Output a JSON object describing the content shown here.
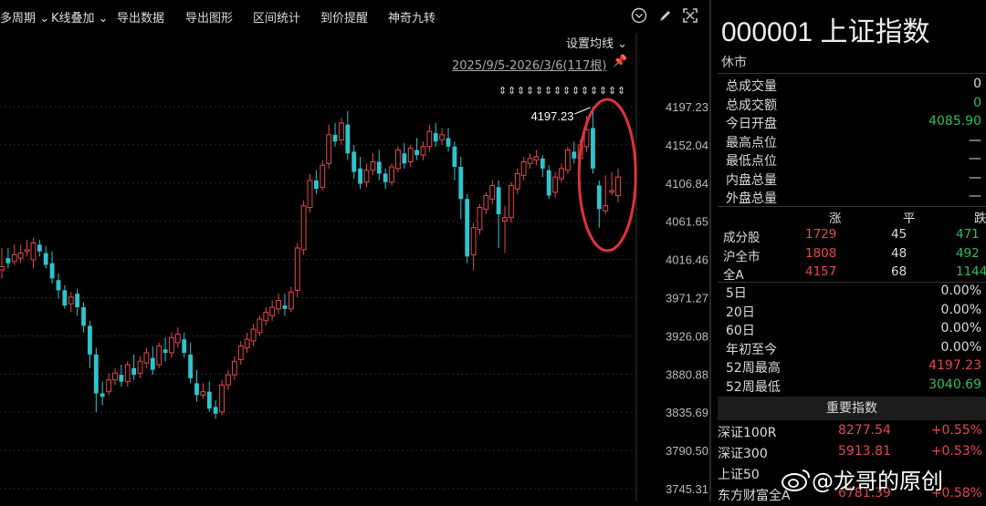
{
  "toolbar": {
    "items": [
      "多周期 ⌄",
      "K线叠加 ⌄",
      "导出数据",
      "导出图形",
      "区间统计",
      "到价提醒",
      "神奇九转"
    ],
    "icons": [
      "chevron-circle-icon",
      "brush-icon",
      "fullscreen-icon"
    ]
  },
  "chart_header": {
    "settings_label": "设置均线 ⌄",
    "range_label": "2025/9/5-2026/3/6(117根)"
  },
  "chart_data": {
    "type": "candlestick",
    "y_ticks": [
      "4197.23",
      "4152.04",
      "4106.84",
      "4061.65",
      "4016.46",
      "3971.27",
      "3926.08",
      "3880.88",
      "3835.69",
      "3790.50",
      "3745.31"
    ],
    "ylim": [
      3745.31,
      4197.23
    ],
    "annotation": "4197.23",
    "highlight": "circled last 6 candles",
    "colors": {
      "up": "#e5484d",
      "down": "#2ec4cc",
      "circle": "#e0323c"
    },
    "candles": [
      [
        4004,
        4030,
        4008,
        3994
      ],
      [
        4018,
        4030,
        4012,
        4006
      ],
      [
        4014,
        4034,
        4022,
        4010
      ],
      [
        4018,
        4034,
        4024,
        4012
      ],
      [
        4026,
        4040,
        4028,
        4020
      ],
      [
        4016,
        4042,
        4036,
        4006
      ],
      [
        4034,
        4040,
        4026,
        4020
      ],
      [
        4024,
        4032,
        4010,
        4006
      ],
      [
        4012,
        4026,
        3994,
        3988
      ],
      [
        3992,
        4000,
        3980,
        3970
      ],
      [
        3980,
        3986,
        3962,
        3958
      ],
      [
        3964,
        3978,
        3972,
        3954
      ],
      [
        3976,
        3982,
        3960,
        3950
      ],
      [
        3960,
        3966,
        3938,
        3930
      ],
      [
        3938,
        3944,
        3904,
        3888
      ],
      [
        3904,
        3912,
        3858,
        3836
      ],
      [
        3858,
        3872,
        3854,
        3844
      ],
      [
        3860,
        3882,
        3874,
        3856
      ],
      [
        3874,
        3888,
        3882,
        3868
      ],
      [
        3880,
        3892,
        3872,
        3866
      ],
      [
        3872,
        3896,
        3892,
        3866
      ],
      [
        3888,
        3904,
        3880,
        3874
      ],
      [
        3882,
        3902,
        3896,
        3876
      ],
      [
        3894,
        3912,
        3906,
        3888
      ],
      [
        3900,
        3914,
        3886,
        3880
      ],
      [
        3892,
        3918,
        3914,
        3888
      ],
      [
        3910,
        3924,
        3906,
        3896
      ],
      [
        3906,
        3930,
        3924,
        3900
      ],
      [
        3918,
        3936,
        3928,
        3912
      ],
      [
        3922,
        3930,
        3906,
        3900
      ],
      [
        3904,
        3918,
        3876,
        3870
      ],
      [
        3870,
        3886,
        3856,
        3848
      ],
      [
        3856,
        3870,
        3860,
        3852
      ],
      [
        3860,
        3872,
        3840,
        3836
      ],
      [
        3842,
        3850,
        3834,
        3828
      ],
      [
        3836,
        3874,
        3868,
        3832
      ],
      [
        3868,
        3886,
        3880,
        3862
      ],
      [
        3880,
        3902,
        3896,
        3874
      ],
      [
        3898,
        3920,
        3914,
        3892
      ],
      [
        3912,
        3930,
        3922,
        3906
      ],
      [
        3920,
        3940,
        3934,
        3914
      ],
      [
        3930,
        3950,
        3946,
        3926
      ],
      [
        3944,
        3960,
        3954,
        3938
      ],
      [
        3950,
        3968,
        3960,
        3944
      ],
      [
        3958,
        3976,
        3968,
        3952
      ],
      [
        3962,
        3976,
        3958,
        3950
      ],
      [
        3958,
        3984,
        3978,
        3954
      ],
      [
        3980,
        4036,
        4030,
        3972
      ],
      [
        4028,
        4086,
        4080,
        4022
      ],
      [
        4078,
        4118,
        4110,
        4072
      ],
      [
        4110,
        4122,
        4100,
        4094
      ],
      [
        4102,
        4134,
        4128,
        4098
      ],
      [
        4130,
        4176,
        4164,
        4124
      ],
      [
        4164,
        4178,
        4156,
        4150
      ],
      [
        4158,
        4184,
        4178,
        4152
      ],
      [
        4176,
        4192,
        4142,
        4134
      ],
      [
        4144,
        4152,
        4120,
        4112
      ],
      [
        4124,
        4138,
        4106,
        4100
      ],
      [
        4108,
        4130,
        4122,
        4102
      ],
      [
        4122,
        4142,
        4132,
        4116
      ],
      [
        4132,
        4146,
        4118,
        4110
      ],
      [
        4118,
        4124,
        4108,
        4100
      ],
      [
        4108,
        4130,
        4126,
        4104
      ],
      [
        4124,
        4150,
        4146,
        4120
      ],
      [
        4142,
        4154,
        4130,
        4124
      ],
      [
        4132,
        4152,
        4148,
        4126
      ],
      [
        4146,
        4160,
        4140,
        4134
      ],
      [
        4140,
        4156,
        4150,
        4134
      ],
      [
        4150,
        4176,
        4168,
        4144
      ],
      [
        4166,
        4178,
        4156,
        4150
      ],
      [
        4158,
        4172,
        4164,
        4152
      ],
      [
        4160,
        4172,
        4150,
        4144
      ],
      [
        4150,
        4156,
        4126,
        4110
      ],
      [
        4126,
        4138,
        4088,
        4064
      ],
      [
        4088,
        4094,
        4020,
        4012
      ],
      [
        4022,
        4060,
        4054,
        4004
      ],
      [
        4052,
        4082,
        4078,
        4046
      ],
      [
        4076,
        4096,
        4092,
        4070
      ],
      [
        4088,
        4110,
        4104,
        4082
      ],
      [
        4102,
        4110,
        4070,
        4030
      ],
      [
        4062,
        4080,
        4066,
        4024
      ],
      [
        4066,
        4108,
        4104,
        4060
      ],
      [
        4100,
        4124,
        4118,
        4094
      ],
      [
        4116,
        4138,
        4132,
        4110
      ],
      [
        4130,
        4142,
        4136,
        4124
      ],
      [
        4134,
        4146,
        4138,
        4128
      ],
      [
        4136,
        4140,
        4124,
        4114
      ],
      [
        4122,
        4128,
        4092,
        4088
      ],
      [
        4096,
        4120,
        4114,
        4090
      ],
      [
        4112,
        4130,
        4124,
        4108
      ],
      [
        4122,
        4150,
        4146,
        4118
      ],
      [
        4144,
        4156,
        4136,
        4130
      ],
      [
        4136,
        4158,
        4152,
        4130
      ],
      [
        4150,
        4186,
        4170,
        4144
      ],
      [
        4172,
        4197.23,
        4124,
        4118
      ],
      [
        4104,
        4110,
        4076,
        4054
      ],
      [
        4074,
        4116,
        4080,
        4070
      ],
      [
        4096,
        4120,
        4098,
        4092
      ],
      [
        4092,
        4124,
        4114,
        4084
      ]
    ]
  },
  "quote": {
    "code_name": "000001 上证指数",
    "status": "休市",
    "stats": [
      {
        "label": "总成交量",
        "value": "0",
        "color": "white"
      },
      {
        "label": "总成交额",
        "value": "0",
        "color": "green"
      },
      {
        "label": "今日开盘",
        "value": "4085.90",
        "color": "green"
      },
      {
        "label": "最高点位",
        "value": "—",
        "color": "white"
      },
      {
        "label": "最低点位",
        "value": "—",
        "color": "white"
      },
      {
        "label": "内盘总量",
        "value": "—",
        "color": "white"
      },
      {
        "label": "外盘总量",
        "value": "—",
        "color": "white"
      }
    ],
    "breadth_header": [
      "涨",
      "平",
      "跌"
    ],
    "breadth": [
      {
        "label": "成分股",
        "up": "1729",
        "flat": "45",
        "down": "471"
      },
      {
        "label": "沪全市",
        "up": "1808",
        "flat": "48",
        "down": "492"
      },
      {
        "label": "全A",
        "up": "4157",
        "flat": "68",
        "down": "1144"
      }
    ],
    "periods": [
      {
        "label": "5日",
        "value": "0.00%",
        "color": "white"
      },
      {
        "label": "20日",
        "value": "0.00%",
        "color": "white"
      },
      {
        "label": "60日",
        "value": "0.00%",
        "color": "white"
      },
      {
        "label": "年初至今",
        "value": "0.00%",
        "color": "white"
      },
      {
        "label": "52周最高",
        "value": "4197.23",
        "color": "red"
      },
      {
        "label": "52周最低",
        "value": "3040.69",
        "color": "green"
      }
    ],
    "section_title": "重要指数",
    "indices": [
      {
        "name": "深证100R",
        "value": "8277.54",
        "change": "+0.55%"
      },
      {
        "name": "深证300",
        "value": "5913.81",
        "change": "+0.53%"
      },
      {
        "name": "上证50",
        "value": "",
        "change": ""
      },
      {
        "name": "东方财富全A",
        "value": "6781.39",
        "change": "+0.58%"
      }
    ],
    "watermark": "@龙哥的原创"
  }
}
